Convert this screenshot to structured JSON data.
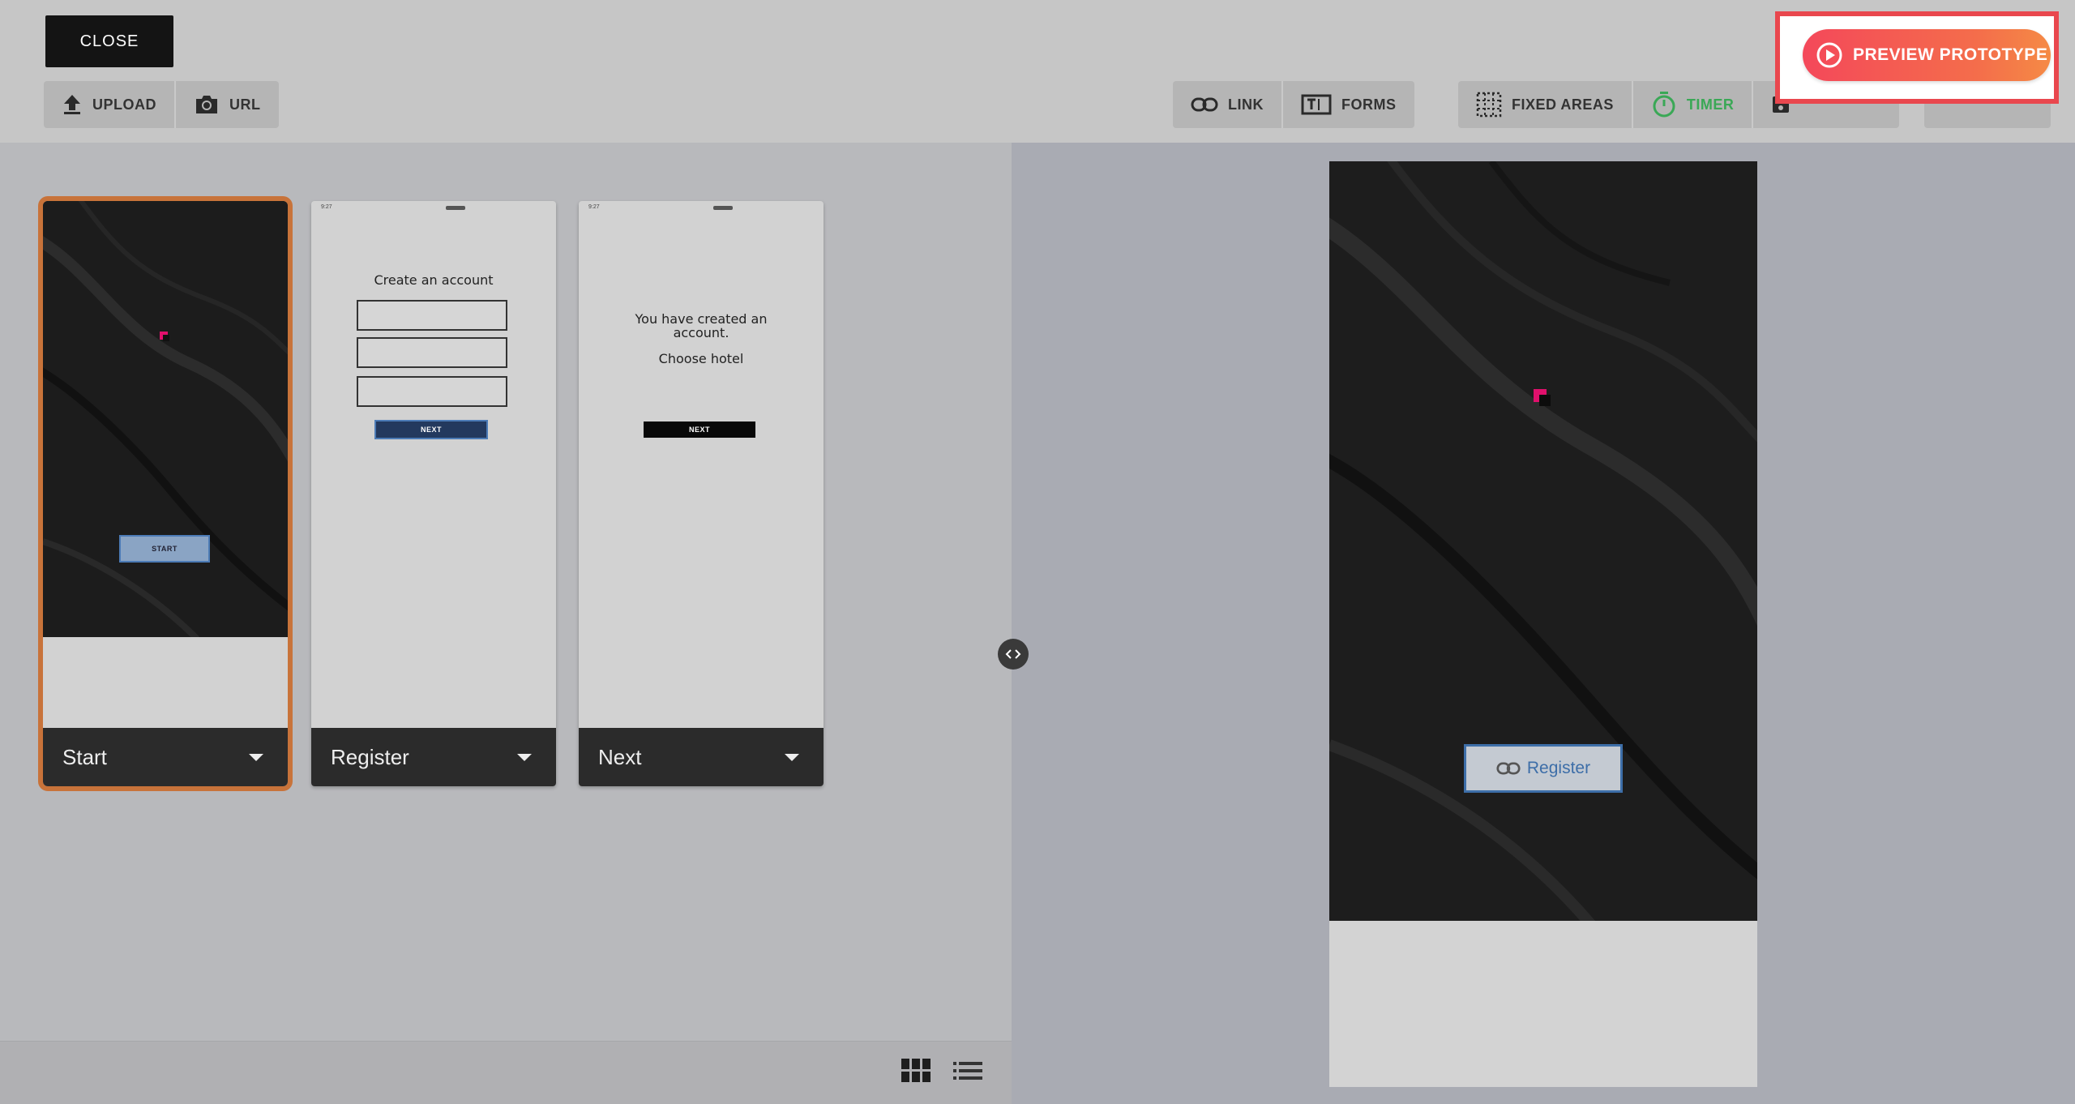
{
  "toolbar": {
    "close_label": "CLOSE",
    "upload_label": "UPLOAD",
    "url_label": "URL",
    "link_label": "LINK",
    "forms_label": "FORMS",
    "fixed_areas_label": "FIXED AREAS",
    "timer_label": "TIMER",
    "preview_label": "PREVIEW PROTOTYPE"
  },
  "screens": [
    {
      "name": "Start",
      "selected": true,
      "button_label": "START"
    },
    {
      "name": "Register",
      "title": "Create an account",
      "button_label": "NEXT",
      "status_time": "9:27"
    },
    {
      "name": "Next",
      "title_line1": "You have created an",
      "title_line2": "account.",
      "subtitle": "Choose hotel",
      "button_label": "NEXT",
      "status_time": "9:27"
    }
  ],
  "preview": {
    "hotspot_label": "Register"
  },
  "colors": {
    "accent_selected": "#c8733a",
    "preview_gradient_start": "#f4485a",
    "preview_gradient_end": "#f58a45",
    "timer_green": "#3aa856",
    "hotspot_blue": "#3d6ea8"
  }
}
